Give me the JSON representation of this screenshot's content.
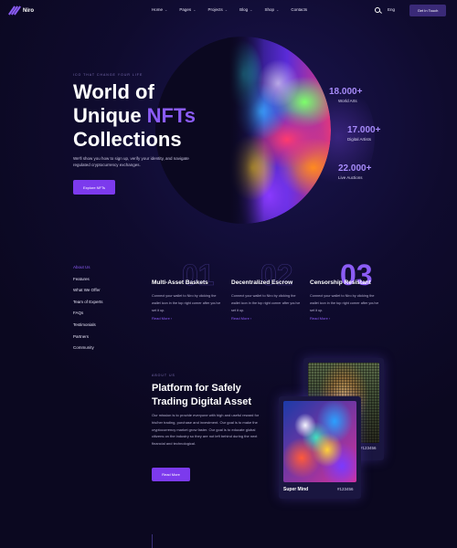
{
  "nav": {
    "logo": "Niro",
    "items": [
      {
        "label": "Home",
        "has_dropdown": true
      },
      {
        "label": "Pages",
        "has_dropdown": true
      },
      {
        "label": "Projects",
        "has_dropdown": true
      },
      {
        "label": "Blog",
        "has_dropdown": true
      },
      {
        "label": "Shop",
        "has_dropdown": true
      },
      {
        "label": "Contacts",
        "has_dropdown": false
      }
    ],
    "language": "Eng",
    "cta": "Get In Touch"
  },
  "hero": {
    "tag": "ICO THAT CHANGE YOUR LIFE",
    "title_line1": "World of",
    "title_line2_a": "Unique ",
    "title_line2_b": "NFTs",
    "title_line3": "Collections",
    "description": "We'll show you how to sign up, verify your identity, and navigate regulated cryptocurrency exchanges.",
    "button": "Explore NFTs",
    "stats": [
      {
        "value": "18.000+",
        "label": "World Arts"
      },
      {
        "value": "17.000+",
        "label": "Digital Artists"
      },
      {
        "value": "22.000+",
        "label": "Live Auctions"
      }
    ]
  },
  "sidebar": {
    "items": [
      {
        "label": "About Us",
        "active": true
      },
      {
        "label": "Features",
        "active": false
      },
      {
        "label": "What We Offer",
        "active": false
      },
      {
        "label": "Team of Experts",
        "active": false
      },
      {
        "label": "FAQs",
        "active": false
      },
      {
        "label": "Testimonials",
        "active": false
      },
      {
        "label": "Partners",
        "active": false
      },
      {
        "label": "Community",
        "active": false
      }
    ]
  },
  "features": [
    {
      "number": "01",
      "title": "Multi-Asset Baskets",
      "description": "Connect your wallet to Niro by clicking the wallet icon in the top right corner after you've set it up.",
      "link": "Read More"
    },
    {
      "number": "02",
      "title": "Decentralized Escrow",
      "description": "Connect your wallet to Niro by clicking the wallet icon in the top right corner after you've set it up.",
      "link": "Read More"
    },
    {
      "number": "03",
      "title": "Censorship Resistant",
      "description": "Connect your wallet to Niro by clicking the wallet icon in the top right corner after you've set it up.",
      "link": "Read More"
    }
  ],
  "about": {
    "tag": "ABOUT US",
    "title": "Platform for Safely Trading Digital Asset",
    "description": "Our mission is to provide everyone with high and useful reward for his/her trading, purchase and investment. Our goal is to make the cryptocurrency market grow faster. Our goal is to educate global citizens on the industry so they are not left behind during the next financial and technological.",
    "button": "Read More"
  },
  "cards": [
    {
      "name": "",
      "id": "#123456"
    },
    {
      "name": "Super Mind",
      "id": "#123456"
    }
  ],
  "colors": {
    "background": "#0b0820",
    "accent": "#8b5cf6",
    "button": "#7c3aed"
  }
}
